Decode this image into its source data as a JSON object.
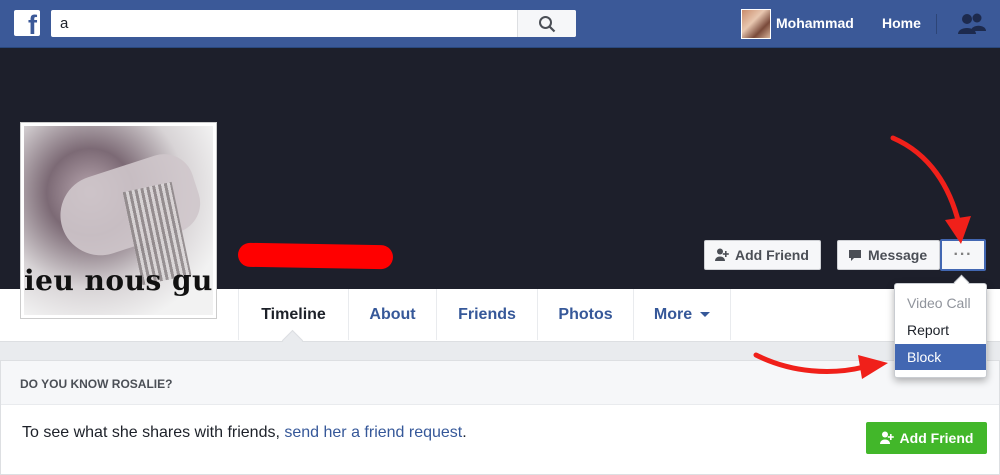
{
  "colors": {
    "brand": "#3b5998",
    "accent": "#4267b2",
    "green": "#42b72a",
    "annotation": "#ff0000"
  },
  "topbar": {
    "logo_letter": "f",
    "search_value": "a",
    "user_name": "Mohammad",
    "home_label": "Home",
    "friends_icon": "friends-icon"
  },
  "profile": {
    "picture_text": "ieu nous gu",
    "add_friend_label": "Add Friend",
    "message_label": "Message",
    "more_label": "···"
  },
  "tabs": [
    {
      "label": "Timeline",
      "active": true
    },
    {
      "label": "About"
    },
    {
      "label": "Friends"
    },
    {
      "label": "Photos"
    },
    {
      "label": "More"
    }
  ],
  "dropdown": {
    "items": [
      {
        "label": "Video Call",
        "state": "disabled"
      },
      {
        "label": "Report"
      },
      {
        "label": "Block",
        "state": "highlighted"
      }
    ]
  },
  "know_card": {
    "title": "DO YOU KNOW ROSALIE?",
    "text_before": "To see what she shares with friends, ",
    "link_text": "send her a friend request",
    "text_after": ".",
    "button_label": "Add Friend"
  }
}
